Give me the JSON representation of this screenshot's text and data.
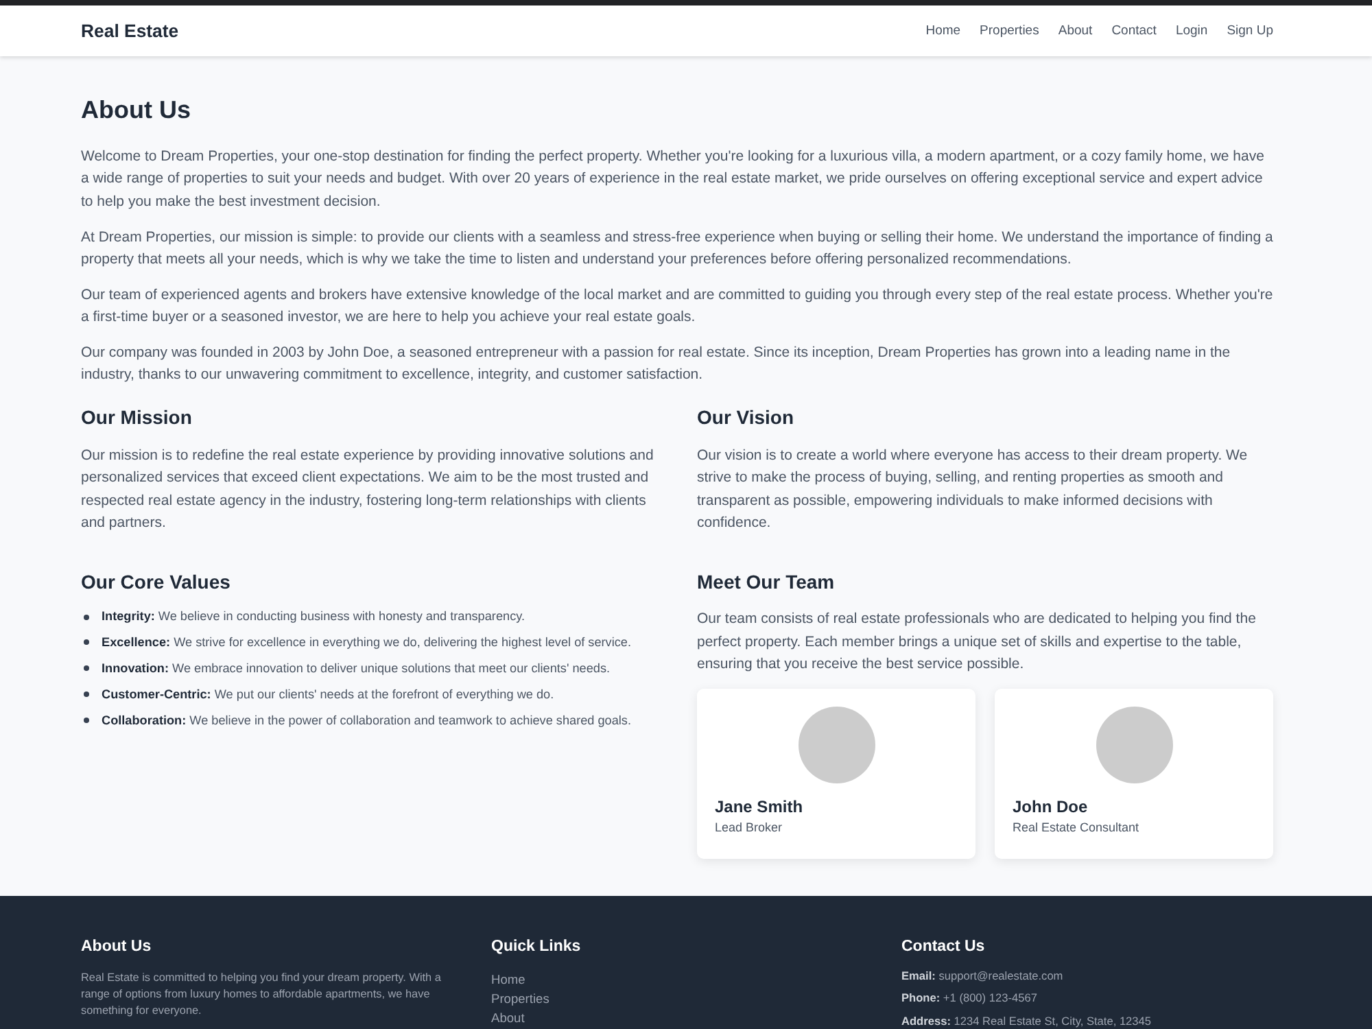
{
  "navbar": {
    "brand": "Real Estate",
    "links": [
      "Home",
      "Properties",
      "About",
      "Contact",
      "Login",
      "Sign Up"
    ]
  },
  "about": {
    "title": "About Us",
    "paragraphs": [
      "Welcome to Dream Properties, your one-stop destination for finding the perfect property. Whether you're looking for a luxurious villa, a modern apartment, or a cozy family home, we have a wide range of properties to suit your needs and budget. With over 20 years of experience in the real estate market, we pride ourselves on offering exceptional service and expert advice to help you make the best investment decision.",
      "At Dream Properties, our mission is simple: to provide our clients with a seamless and stress-free experience when buying or selling their home. We understand the importance of finding a property that meets all your needs, which is why we take the time to listen and understand your preferences before offering personalized recommendations.",
      "Our team of experienced agents and brokers have extensive knowledge of the local market and are committed to guiding you through every step of the real estate process. Whether you're a first-time buyer or a seasoned investor, we are here to help you achieve your real estate goals.",
      "Our company was founded in 2003 by John Doe, a seasoned entrepreneur with a passion for real estate. Since its inception, Dream Properties has grown into a leading name in the industry, thanks to our unwavering commitment to excellence, integrity, and customer satisfaction."
    ]
  },
  "mission": {
    "title": "Our Mission",
    "text": "Our mission is to redefine the real estate experience by providing innovative solutions and personalized services that exceed client expectations. We aim to be the most trusted and respected real estate agency in the industry, fostering long-term relationships with clients and partners."
  },
  "vision": {
    "title": "Our Vision",
    "text": "Our vision is to create a world where everyone has access to their dream property. We strive to make the process of buying, selling, and renting properties as smooth and transparent as possible, empowering individuals to make informed decisions with confidence."
  },
  "core_values": {
    "title": "Our Core Values",
    "items": [
      "**Integrity:** We believe in conducting business with honesty and transparency.",
      "**Excellence:** We strive for excellence in everything we do, delivering the highest level of service.",
      "**Innovation:** We embrace innovation to deliver unique solutions that meet our clients' needs.",
      "**Customer-Centric:** We put our clients' needs at the forefront of everything we do.",
      "**Collaboration:** We believe in the power of collaboration and teamwork to achieve shared goals."
    ]
  },
  "team": {
    "title": "Meet Our Team",
    "intro": "Our team consists of real estate professionals who are dedicated to helping you find the perfect property. Each member brings a unique set of skills and expertise to the table, ensuring that you receive the best service possible.",
    "members": [
      {
        "name": "Jane Smith",
        "role": "Lead Broker"
      },
      {
        "name": "John Doe",
        "role": "Real Estate Consultant"
      }
    ]
  },
  "footer": {
    "about": {
      "title": "About Us",
      "text": "Real Estate is committed to helping you find your dream property. With a range of options from luxury homes to affordable apartments, we have something for everyone."
    },
    "quick_links": {
      "title": "Quick Links",
      "links": [
        "Home",
        "Properties",
        "About"
      ]
    },
    "contact": {
      "title": "Contact Us",
      "items": [
        "**Email:** support@realestate.com",
        "**Phone:** +1 (800) 123-4567",
        "**Address:** 1234 Real Estate St, City, State, 12345"
      ]
    }
  }
}
